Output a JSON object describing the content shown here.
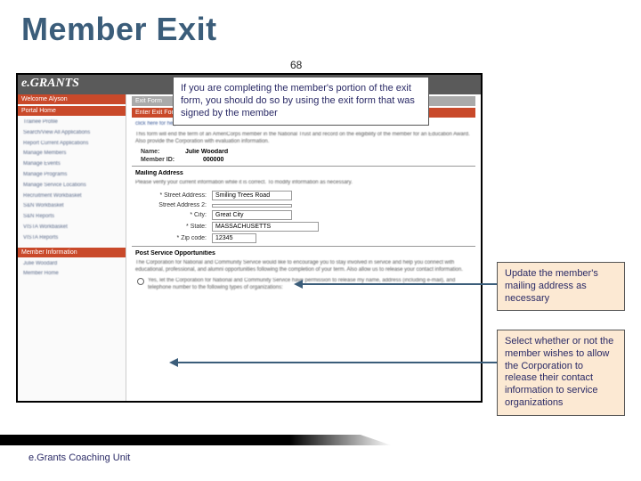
{
  "title": "Member Exit",
  "page_number": "68",
  "callouts": {
    "top": "If you are completing the member's portion of the exit form, you should do so by using the exit form that was signed by the member",
    "mid": "Update the member's mailing address as necessary",
    "bot": "Select whether or not the member wishes to allow the Corporation to release their contact information to service organizations"
  },
  "screenshot": {
    "logo": "e.GRANTS",
    "sidebar_heads": {
      "welcome": "Welcome Alyson",
      "portal": "Portal Home",
      "member": "Member Information"
    },
    "sidebar_items_a": [
      "Trainee Profile",
      "Search/View All Applications",
      "Report Current Applications",
      "Manage Members",
      "Manage Events",
      "Manage Programs",
      "Manage Service Locations",
      "Recruitment Workbasket",
      "S&N Workbasket",
      "S&N Reports",
      "VISTA Workbasket",
      "VISTA Reports"
    ],
    "sidebar_items_b": [
      "Julie Woodard",
      "Member Home"
    ],
    "main": {
      "exit_form_bar": "Exit Form",
      "enter_info_bar": "Enter Exit Form Information",
      "link1": "click here for help",
      "intro": "This form will end the term of an AmeriCorps member in the National Trust and record on the eligibility of the member for an Education Award. Also provide the Corporation with evaluation information.",
      "name_label": "Name:",
      "name_value": "Julie Woodard",
      "id_label": "Member ID:",
      "id_value": "000000",
      "mailing_header": "Mailing Address",
      "mailing_para": "Please verify your current information while it is correct. To modify information as necessary.",
      "street1_label": "* Street Address:",
      "street1_value": "Smiling Trees Road",
      "street2_label": "Street Address 2:",
      "city_label": "* City:",
      "city_value": "Great City",
      "state_label": "* State:",
      "state_value": "MASSACHUSETTS",
      "zip_label": "* Zip code:",
      "zip_value": "12345",
      "post_header": "Post Service Opportunities",
      "post_para": "The Corporation for National and Community Service would like to encourage you to stay involved in service and help you connect with educational, professional, and alumni opportunities following the completion of your term. Also allow us to release your contact information.",
      "consent": "Yes, let the Corporation for National and Community Service have permission to release my name, address (including e-mail), and telephone number to the following types of organizations:"
    }
  },
  "footer": "e.Grants Coaching Unit"
}
